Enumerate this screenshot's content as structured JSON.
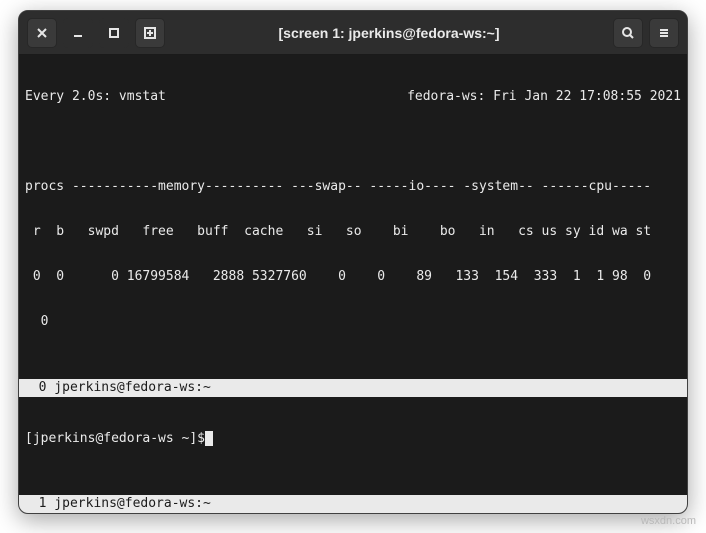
{
  "window": {
    "title": "[screen 1: jperkins@fedora-ws:~]"
  },
  "watch": {
    "header_left": "Every 2.0s: vmstat",
    "header_right": "fedora-ws: Fri Jan 22 17:08:55 2021"
  },
  "vmstat": {
    "section_line": "procs -----------memory---------- ---swap-- -----io---- -system-- ------cpu-----",
    "header_line": " r  b   swpd   free   buff  cache   si   so    bi    bo   in   cs us sy id wa st",
    "data_line": " 0  0      0 16799584   2888 5327760    0    0    89   133  154  333  1  1 98  0",
    "wrap_line": "  0"
  },
  "screen": {
    "pane0_status": "  0 jperkins@fedora-ws:~",
    "pane1_status": "  1 jperkins@fedora-ws:~"
  },
  "shell": {
    "prompt": "[jperkins@fedora-ws ~]$"
  },
  "watermark": "wsxdn.com"
}
